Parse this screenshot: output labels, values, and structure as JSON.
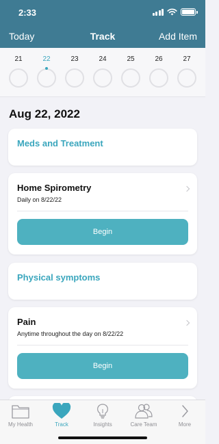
{
  "status_bar": {
    "time": "2:33"
  },
  "nav": {
    "left": "Today",
    "title": "Track",
    "right": "Add Item"
  },
  "days": [
    {
      "number": "21",
      "selected": false
    },
    {
      "number": "22",
      "selected": true
    },
    {
      "number": "23",
      "selected": false
    },
    {
      "number": "24",
      "selected": false
    },
    {
      "number": "25",
      "selected": false
    },
    {
      "number": "26",
      "selected": false
    },
    {
      "number": "27",
      "selected": false
    }
  ],
  "section_date": "Aug 22, 2022",
  "cards": {
    "meds_header": "Meds and Treatment",
    "spirometry": {
      "title": "Home Spirometry",
      "subtitle": "Daily on 8/22/22",
      "button": "Begin"
    },
    "symptoms_header": "Physical symptoms",
    "pain": {
      "title": "Pain",
      "subtitle": "Anytime throughout the day on 8/22/22",
      "button": "Begin"
    }
  },
  "tabbar": {
    "items": [
      {
        "label": "My Health",
        "icon": "folder-icon",
        "active": false
      },
      {
        "label": "Track",
        "icon": "heart-icon",
        "active": true
      },
      {
        "label": "Insights",
        "icon": "lightbulb-icon",
        "active": false
      },
      {
        "label": "Care Team",
        "icon": "people-icon",
        "active": false
      },
      {
        "label": "More",
        "icon": "chevron-right-icon",
        "active": false
      }
    ]
  },
  "colors": {
    "header": "#3f7b93",
    "accent": "#3aa6bd",
    "button": "#4eb1c0",
    "background": "#f2f2f7"
  }
}
